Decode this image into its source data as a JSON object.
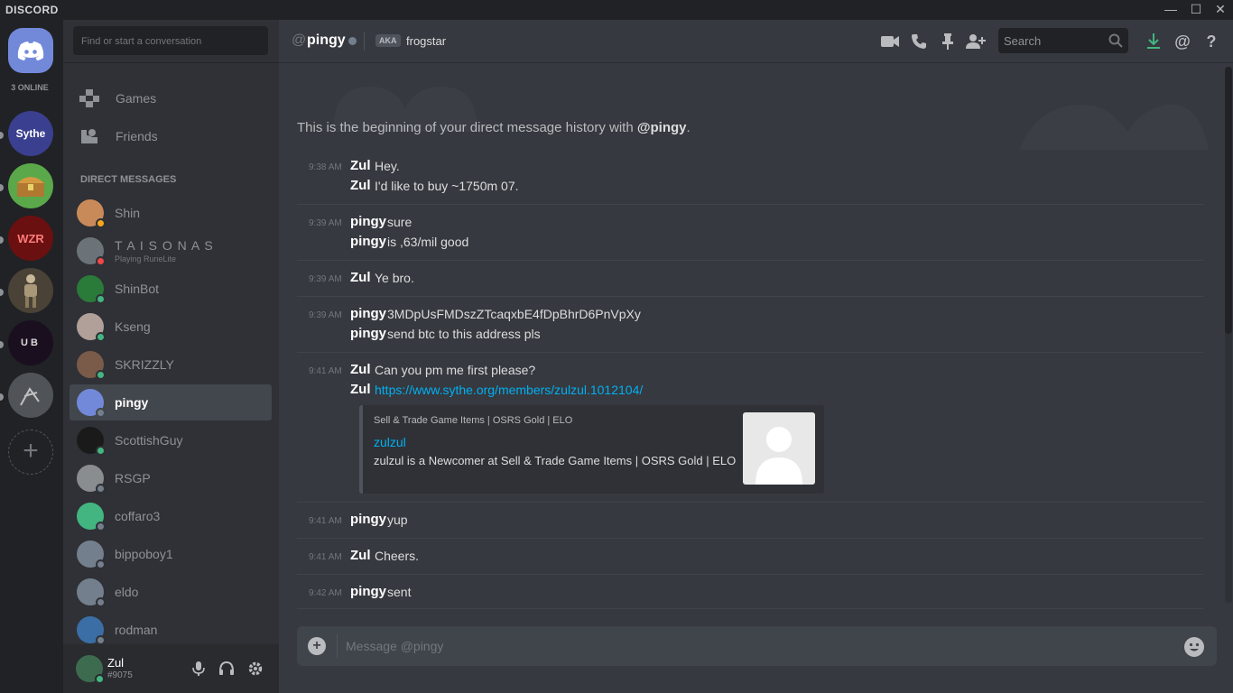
{
  "app": {
    "brand": "DISCORD"
  },
  "window": {
    "minimize": "—",
    "maximize": "☐",
    "close": "✕"
  },
  "guilds": {
    "online_count": "3 ONLINE",
    "add": "+",
    "items": [
      "Sythe",
      "WZR",
      "UB"
    ]
  },
  "sidebar": {
    "search_placeholder": "Find or start a conversation",
    "nav": [
      {
        "label": "Games",
        "icon": "gamepad-icon"
      },
      {
        "label": "Friends",
        "icon": "friends-icon"
      }
    ],
    "dm_header": "DIRECT MESSAGES",
    "dms": [
      {
        "name": "Shin",
        "status": "#faa61a",
        "avatar": "#c98a5a"
      },
      {
        "name": "T A I S O N A S",
        "sub": "Playing RuneLite",
        "status": "#f04747",
        "avatar": "#6b7378"
      },
      {
        "name": "ShinBot",
        "status": "#43b581",
        "avatar": "#2a7a3a"
      },
      {
        "name": "Kseng",
        "status": "#43b581",
        "avatar": "#b0a099"
      },
      {
        "name": "SKRIZZLY",
        "status": "#43b581",
        "avatar": "#7a5a48"
      },
      {
        "name": "pingy",
        "status": "#747f8d",
        "avatar": "#7289da"
      },
      {
        "name": "ScottishGuy",
        "status": "#43b581",
        "avatar": "#1a1a1a"
      },
      {
        "name": "RSGP",
        "status": "#747f8d",
        "avatar": "#8a8d90"
      },
      {
        "name": "coffaro3",
        "status": "#747f8d",
        "avatar": "#43b581"
      },
      {
        "name": "bippoboy1",
        "status": "#747f8d",
        "avatar": "#747f8d"
      },
      {
        "name": "eldo",
        "status": "#747f8d",
        "avatar": "#747f8d"
      },
      {
        "name": "rodman",
        "status": "#747f8d",
        "avatar": "#3a6ea5"
      }
    ],
    "user": {
      "name": "Zul",
      "tag": "#9075"
    }
  },
  "header": {
    "at": "@",
    "name": "pingy",
    "aka": "AKA",
    "nickname": "frogstar",
    "search_placeholder": "Search"
  },
  "chat": {
    "beginning_prefix": "This is the beginning of your direct message history with ",
    "beginning_user": "@pingy",
    "beginning_suffix": ".",
    "groups": [
      {
        "time": "9:38 AM",
        "lines": [
          {
            "author": "Zul",
            "text": "Hey."
          },
          {
            "author": "Zul",
            "text": "I'd like to buy ~1750m 07."
          }
        ]
      },
      {
        "time": "9:39 AM",
        "lines": [
          {
            "author": "pingy",
            "text": "sure"
          },
          {
            "author": "pingy",
            "text": "is ,63/mil good"
          }
        ]
      },
      {
        "time": "9:39 AM",
        "lines": [
          {
            "author": "Zul",
            "text": "Ye bro."
          }
        ]
      },
      {
        "time": "9:39 AM",
        "lines": [
          {
            "author": "pingy",
            "text": "3MDpUsFMDszZTcaqxbE4fDpBhrD6PnVpXy"
          },
          {
            "author": "pingy",
            "text": "send btc to this address pls"
          }
        ]
      },
      {
        "time": "9:41 AM",
        "lines": [
          {
            "author": "Zul",
            "text": "Can you pm me first please?"
          },
          {
            "author": "Zul",
            "text": "https://www.sythe.org/members/zulzul.1012104/",
            "link": true
          }
        ]
      },
      {
        "time": "9:41 AM",
        "lines": [
          {
            "author": "pingy",
            "text": "yup"
          }
        ]
      },
      {
        "time": "9:41 AM",
        "lines": [
          {
            "author": "Zul",
            "text": "Cheers."
          }
        ]
      },
      {
        "time": "9:42 AM",
        "lines": [
          {
            "author": "pingy",
            "text": "sent"
          }
        ]
      }
    ],
    "embed": {
      "provider": "Sell & Trade Game Items | OSRS Gold | ELO",
      "title": "zulzul",
      "description": "zulzul is a Newcomer at Sell & Trade Game Items | OSRS Gold | ELO"
    }
  },
  "composer": {
    "placeholder": "Message @pingy"
  },
  "colors": {
    "blurple": "#7289da",
    "link": "#00b0f4",
    "online": "#43b581",
    "idle": "#faa61a",
    "dnd": "#f04747",
    "offline": "#747f8d"
  }
}
